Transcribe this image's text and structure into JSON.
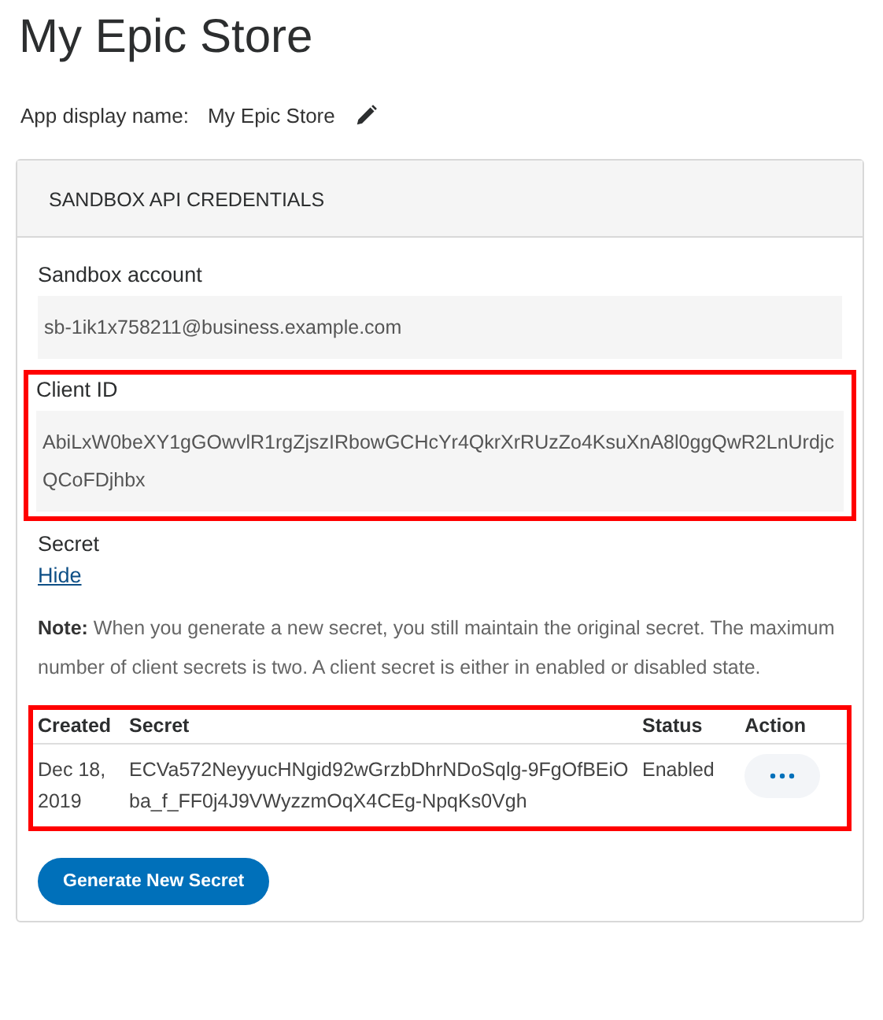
{
  "page_title": "My Epic Store",
  "app_display_name": {
    "label": "App display name:",
    "value": "My Epic Store"
  },
  "credentials": {
    "heading": "SANDBOX API CREDENTIALS",
    "fields": [
      {
        "label": "Sandbox account",
        "value": "sb-1ik1x758211@business.example.com",
        "highlighted": false
      },
      {
        "label": "Client ID",
        "value": "AbiLxW0beXY1gGOwvlR1rgZjszIRbowGCHcYr4QkrXrRUzZo4KsuXnA8l0ggQwR2LnUrdjcQCoFDjhbx",
        "highlighted": true
      }
    ],
    "secret": {
      "label": "Secret",
      "link": "Hide"
    },
    "note": "**Note:** When you generate a new secret, you still maintain the original secret. The maximum number of client secrets is two. A client secret is either in enabled or disabled state.",
    "table": {
      "highlighted": true,
      "columns": [
        "Created",
        "Secret",
        "Status",
        "Action"
      ],
      "rows": [
        {
          "created": "Dec 18, 2019",
          "secret": "ECVa572NeyyucHNgid92wGrzbDhrNDoSqlg-9FgOfBEiOba_f_FF0j4J9VWyzzmOqX4CEg-NpqKs0Vgh",
          "status": "Enabled"
        }
      ]
    },
    "button": "Generate New Secret"
  }
}
